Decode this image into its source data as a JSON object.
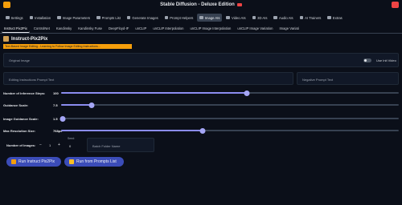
{
  "app": {
    "title": "Stable Diffusion - Deluxe Edition"
  },
  "main_tabs": [
    {
      "label": "Settings",
      "icon": "gear-icon"
    },
    {
      "label": "Installation",
      "icon": "wrench-icon"
    },
    {
      "label": "Image Parameters",
      "icon": "image-icon"
    },
    {
      "label": "Prompts List",
      "icon": "list-icon"
    },
    {
      "label": "Generate Images",
      "icon": "image-icon"
    },
    {
      "label": "Prompt Helpers",
      "icon": "bulb-icon"
    },
    {
      "label": "Image AIs",
      "icon": "image-icon",
      "active": true
    },
    {
      "label": "Video AIs",
      "icon": "video-icon"
    },
    {
      "label": "3D AIs",
      "icon": "cube-icon"
    },
    {
      "label": "Audio AIs",
      "icon": "audio-icon"
    },
    {
      "label": "AI Trainers",
      "icon": "trainer-icon"
    },
    {
      "label": "Extras",
      "icon": "extras-icon"
    }
  ],
  "sub_tabs": [
    {
      "label": "Instruct Pix2Pix",
      "active": true
    },
    {
      "label": "ControlNet"
    },
    {
      "label": "Kandinsky"
    },
    {
      "label": "Kandinsky Fuse"
    },
    {
      "label": "DeepFloyd-IF"
    },
    {
      "label": "unCLIP"
    },
    {
      "label": "unCLIP Interpolation"
    },
    {
      "label": "unCLIP Image Interpolation"
    },
    {
      "label": "unCLIP Image Variation"
    },
    {
      "label": "Image Variati"
    }
  ],
  "section": {
    "title": "Instruct-Pix2Pix",
    "subtitle": "Text-Based Image Editing - Learning to Follow Image Editing Instructions..."
  },
  "original_image": {
    "label": "Original Image",
    "toggle_label": "Use Init Video",
    "toggle_on": false
  },
  "prompts": {
    "editing_label": "Editing Instructions Prompt Text",
    "negative_label": "Negative Prompt Text"
  },
  "sliders": [
    {
      "name": "Number of Inference Steps:",
      "value": "100",
      "fraction": 0.55
    },
    {
      "name": "Guidance Scale:",
      "value": "7.5",
      "fraction": 0.09
    },
    {
      "name": "Image Guidance Scale:",
      "value": "1.5",
      "fraction": 0.005
    },
    {
      "name": "Max Resolution Size:",
      "value": "768px",
      "fraction": 0.42
    }
  ],
  "batch": {
    "num_images_label": "Number of Images:",
    "minus": "−",
    "num_images_value": "1",
    "plus": "+",
    "seed_label": "Seed:",
    "seed_value": "0",
    "folder_placeholder": "Batch Folder Name"
  },
  "buttons": {
    "run_label": "Run Instruct Pix2Pix",
    "run_list_label": "Run from Prompts List"
  }
}
